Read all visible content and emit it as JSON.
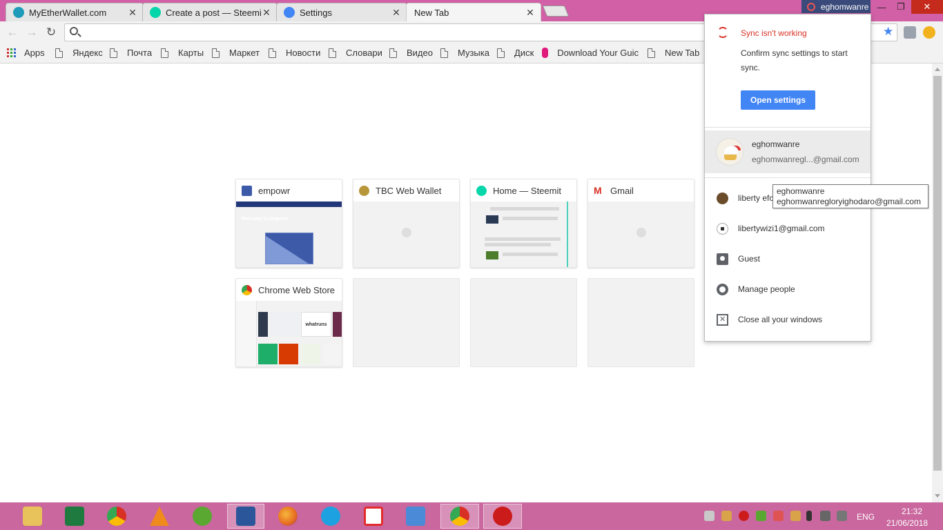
{
  "tabs": [
    {
      "title": "MyEtherWallet.com",
      "close": "✕",
      "icon_color": "#1e9bb8"
    },
    {
      "title": "Create a post — Steemit",
      "close": "✕",
      "icon_color": "#06d6a9"
    },
    {
      "title": "Settings",
      "close": "✕",
      "icon_color": "#4285f4"
    },
    {
      "title": "New Tab",
      "close": "✕"
    }
  ],
  "profile_button": {
    "label": "eghomwanre"
  },
  "window_controls": {
    "minimize": "—",
    "restore": "❐",
    "close": "✕"
  },
  "toolbar": {
    "back": "←",
    "forward": "→",
    "reload": "↻",
    "star": "★",
    "omnibox_value": ""
  },
  "bookmarks": [
    {
      "label": "Apps"
    },
    {
      "label": "Яндекс"
    },
    {
      "label": "Почта"
    },
    {
      "label": "Карты"
    },
    {
      "label": "Маркет"
    },
    {
      "label": "Новости"
    },
    {
      "label": "Словари"
    },
    {
      "label": "Видео"
    },
    {
      "label": "Музыка"
    },
    {
      "label": "Диск"
    },
    {
      "label": "Download Your Guic"
    },
    {
      "label": "New Tab"
    }
  ],
  "tiles": [
    {
      "title": "empowr",
      "icon_color": "#3b5aa8",
      "thumb_headline": "Welcome to empowr"
    },
    {
      "title": "TBC Web Wallet",
      "icon_color": "#b8963a"
    },
    {
      "title": "Home — Steemit",
      "icon_color": "#06d6a9"
    },
    {
      "title": "Gmail",
      "icon_color": "#d93025"
    },
    {
      "title": "Chrome Web Store",
      "icon_color": "#4285f4",
      "thumb_badge": "whatruns"
    },
    {
      "title": ""
    },
    {
      "title": ""
    },
    {
      "title": ""
    }
  ],
  "profile_menu": {
    "sync_title": "Sync isn't working",
    "sync_desc": "Confirm sync settings to start sync.",
    "open_settings": "Open settings",
    "current_user": {
      "name": "eghomwanre",
      "email": "eghomwanregl...@gmail.com"
    },
    "other_users": [
      {
        "name": "liberty efc"
      },
      {
        "name": "libertywizi1@gmail.com"
      }
    ],
    "guest": "Guest",
    "manage_people": "Manage people",
    "close_all": "Close all your windows"
  },
  "tooltip": {
    "line1": "eghomwanre",
    "line2": "eghomwanregloryighodaro@gmail.com"
  },
  "taskbar": {
    "apps": [
      {
        "name": "file-explorer",
        "color": "#e8c25a"
      },
      {
        "name": "excel",
        "color": "#1f7a3f"
      },
      {
        "name": "chrome",
        "color": "#e0453a"
      },
      {
        "name": "vlc",
        "color": "#f08a1c"
      },
      {
        "name": "utorrent",
        "color": "#5aa832"
      },
      {
        "name": "word",
        "color": "#2b579a"
      },
      {
        "name": "firefox",
        "color": "#e66b1f"
      },
      {
        "name": "internet-explorer",
        "color": "#1ea1e0"
      },
      {
        "name": "yandex",
        "color": "#e32b2b"
      },
      {
        "name": "mail",
        "color": "#4a8ad6"
      },
      {
        "name": "chrome-open",
        "color": "#e0453a"
      },
      {
        "name": "opera",
        "color": "#cc1b1b"
      }
    ],
    "language": "ENG",
    "time": "21:32",
    "date": "21/06/2018"
  }
}
